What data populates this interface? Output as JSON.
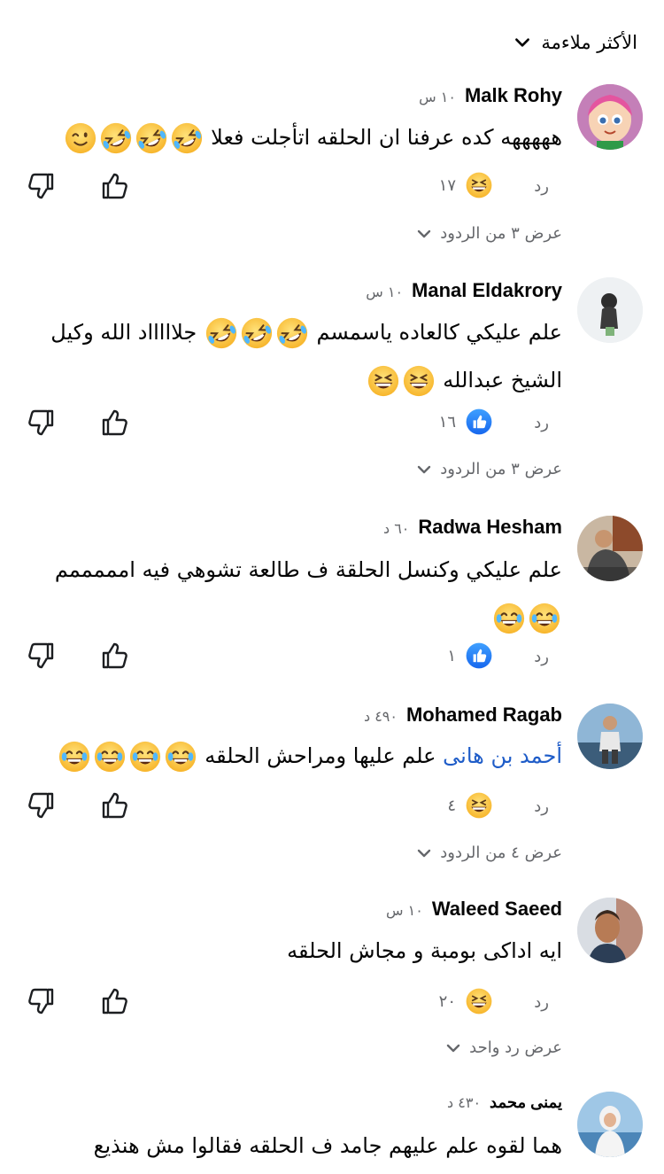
{
  "sort": {
    "label": "الأكثر ملاءمة",
    "icon": "chevron-down-icon"
  },
  "actions": {
    "reply_label": "رد",
    "like_icon": "thumbs-up-icon",
    "dislike_icon": "thumbs-down-icon"
  },
  "comments": [
    {
      "name": "Malk Rohy",
      "time": "١٠ س",
      "text": "هههههه كده عرفنا ان الحلقه اتأجلت فعلا",
      "emojis": [
        "rofl",
        "rofl",
        "rofl",
        "wink"
      ],
      "reaction": {
        "icon": "laugh-reaction-icon",
        "count": "١٧"
      },
      "view_replies": "عرض ٣ من الردود"
    },
    {
      "name": "Manal Eldakrory",
      "time": "١٠ س",
      "text_line1": "علم عليكي كالعاده ياسمسم",
      "text_line1_after": "جلاااااد الله وكيل",
      "text_line2": "الشيخ عبدالله",
      "emojis_line1": [
        "rofl",
        "rofl",
        "rofl"
      ],
      "emojis_line2": [
        "grin",
        "grin"
      ],
      "reaction": {
        "icon": "like-reaction-icon",
        "count": "١٦"
      },
      "view_replies": "عرض ٣ من الردود"
    },
    {
      "name": "Radwa Hesham",
      "time": "٦٠ د",
      "text": "علم عليكي وكنسل الحلقة ف طالعة تشوهي فيه امممممم",
      "emojis": [
        "joy",
        "joy"
      ],
      "reaction": {
        "icon": "like-reaction-icon",
        "count": "١"
      }
    },
    {
      "name": "Mohamed Ragab",
      "time": "٤٩٠ د",
      "mention": "أحمد بن هانى",
      "text": "علم عليها ومراحش الحلقه",
      "emojis": [
        "joy",
        "joy",
        "joy",
        "joy"
      ],
      "reaction": {
        "icon": "laugh-reaction-icon",
        "count": "٤"
      },
      "view_replies": "عرض ٤ من الردود"
    },
    {
      "name": "Waleed Saeed",
      "time": "١٠ س",
      "text": "ايه اداكى بومبة و مجاش الحلقه",
      "reaction": {
        "icon": "laugh-reaction-icon",
        "count": "٢٠"
      },
      "view_replies": "عرض رد واحد"
    },
    {
      "name": "يمنى محمد",
      "time": "٤٣٠ د",
      "text": "هما لقوه علم عليهم جامد ف الحلقه فقالوا مش هنذيع"
    }
  ]
}
